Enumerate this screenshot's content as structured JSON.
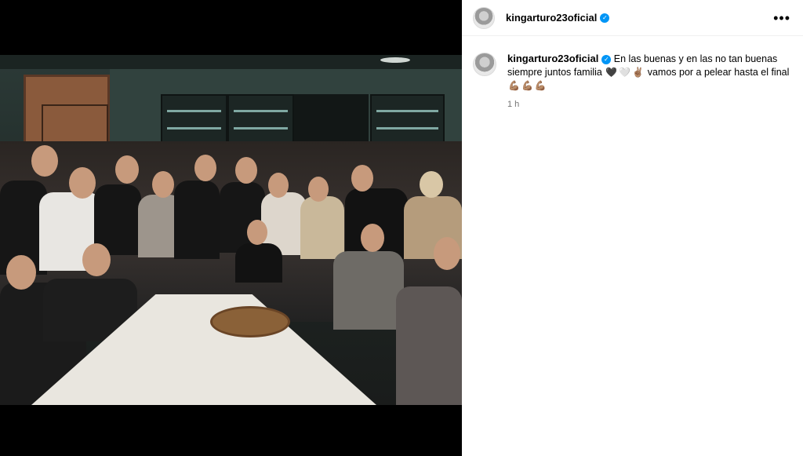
{
  "post": {
    "username": "kingarturo23oficial",
    "verified": true,
    "more_icon": "more-horizontal-icon"
  },
  "caption": {
    "username": "kingarturo23oficial",
    "text": "En las buenas y en las no tan buenas siempre juntos familia",
    "emojis_a": [
      "🖤",
      "🤍",
      "✌🏽"
    ],
    "text2": "vamos por a pelear hasta el final",
    "emojis_b": [
      "💪🏽",
      "💪🏽",
      "💪🏽"
    ],
    "time": "1 h"
  },
  "colors": {
    "verified": "#0095f6",
    "meta_text": "#737373",
    "background": "#ffffff"
  }
}
